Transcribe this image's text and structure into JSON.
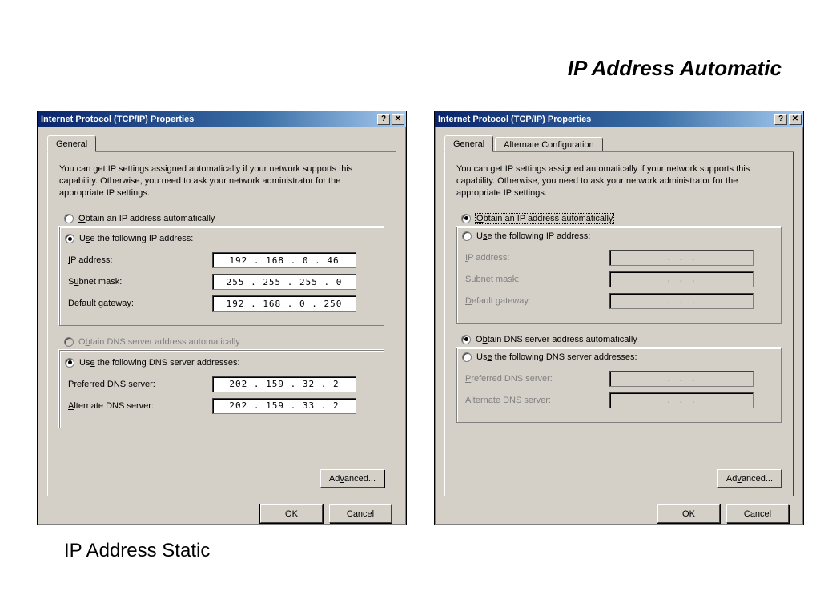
{
  "titles": {
    "top": "IP Address Automatic",
    "bottom": "IP Address Static"
  },
  "common": {
    "window_title": "Internet Protocol (TCP/IP) Properties",
    "help_btn": "?",
    "close_btn": "✕",
    "tab_general": "General",
    "tab_alternate": "Alternate Configuration",
    "description": "You can get IP settings assigned automatically if your network supports this capability. Otherwise, you need to ask your network administrator for the appropriate IP settings.",
    "opt_obtain_ip": "Obtain an IP address automatically",
    "opt_use_ip": "Use the following IP address:",
    "lbl_ip": "IP address:",
    "lbl_subnet": "Subnet mask:",
    "lbl_gateway": "Default gateway:",
    "opt_obtain_dns": "Obtain DNS server address automatically",
    "opt_use_dns": "Use the following DNS server addresses:",
    "lbl_pref_dns": "Preferred DNS server:",
    "lbl_alt_dns": "Alternate DNS server:",
    "btn_advanced": "Advanced...",
    "btn_ok": "OK",
    "btn_cancel": "Cancel",
    "ip_placeholder": ".       .       ."
  },
  "left": {
    "ip": "192 . 168 .   0   .  46",
    "subnet": "255 . 255 . 255 .   0",
    "gateway": "192 . 168 .   0   . 250",
    "pref_dns": "202 . 159 .  32  .   2",
    "alt_dns": "202 . 159 .  33  .   2"
  }
}
